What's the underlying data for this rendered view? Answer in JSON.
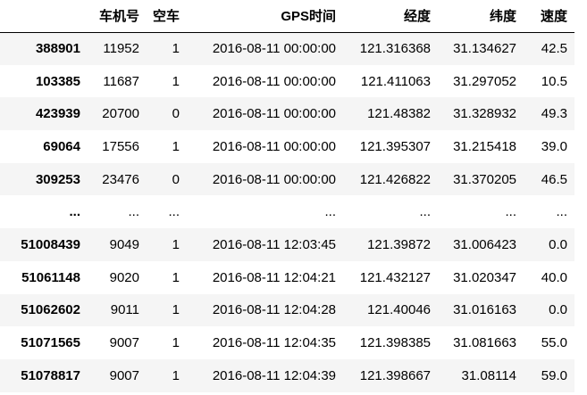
{
  "table": {
    "columns": [
      "",
      "车机号",
      "空车",
      "GPS时间",
      "经度",
      "纬度",
      "速度"
    ],
    "rows": [
      {
        "index": "388901",
        "cells": [
          "11952",
          "1",
          "2016-08-11 00:00:00",
          "121.316368",
          "31.134627",
          "42.5"
        ]
      },
      {
        "index": "103385",
        "cells": [
          "11687",
          "1",
          "2016-08-11 00:00:00",
          "121.411063",
          "31.297052",
          "10.5"
        ]
      },
      {
        "index": "423939",
        "cells": [
          "20700",
          "0",
          "2016-08-11 00:00:00",
          "121.48382",
          "31.328932",
          "49.3"
        ]
      },
      {
        "index": "69064",
        "cells": [
          "17556",
          "1",
          "2016-08-11 00:00:00",
          "121.395307",
          "31.215418",
          "39.0"
        ]
      },
      {
        "index": "309253",
        "cells": [
          "23476",
          "0",
          "2016-08-11 00:00:00",
          "121.426822",
          "31.370205",
          "46.5"
        ]
      },
      {
        "index": "...",
        "cells": [
          "...",
          "...",
          "...",
          "...",
          "...",
          "..."
        ]
      },
      {
        "index": "51008439",
        "cells": [
          "9049",
          "1",
          "2016-08-11 12:03:45",
          "121.39872",
          "31.006423",
          "0.0"
        ]
      },
      {
        "index": "51061148",
        "cells": [
          "9020",
          "1",
          "2016-08-11 12:04:21",
          "121.432127",
          "31.020347",
          "40.0"
        ]
      },
      {
        "index": "51062602",
        "cells": [
          "9011",
          "1",
          "2016-08-11 12:04:28",
          "121.40046",
          "31.016163",
          "0.0"
        ]
      },
      {
        "index": "51071565",
        "cells": [
          "9007",
          "1",
          "2016-08-11 12:04:35",
          "121.398385",
          "31.081663",
          "55.0"
        ]
      },
      {
        "index": "51078817",
        "cells": [
          "9007",
          "1",
          "2016-08-11 12:04:39",
          "121.398667",
          "31.08114",
          "59.0"
        ]
      }
    ]
  }
}
